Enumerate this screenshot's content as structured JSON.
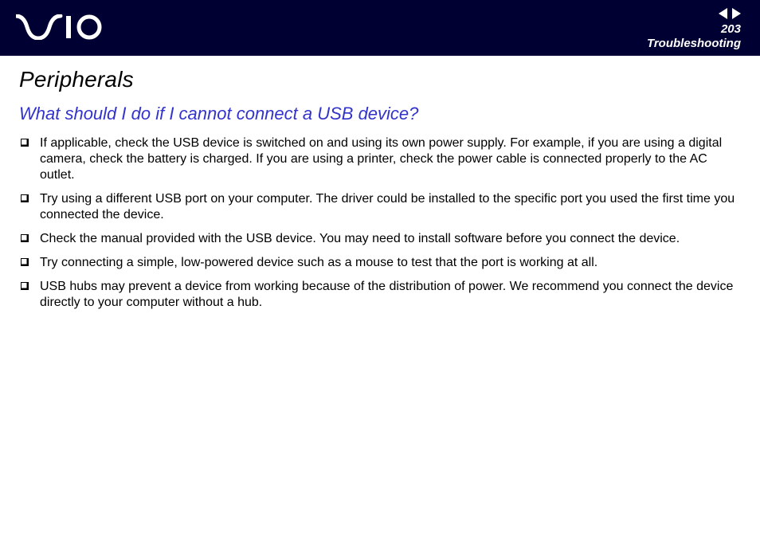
{
  "header": {
    "page_number": "203",
    "section": "Troubleshooting"
  },
  "content": {
    "title": "Peripherals",
    "question": "What should I do if I cannot connect a USB device?",
    "items": [
      "If applicable, check the USB device is switched on and using its own power supply. For example, if you are using a digital camera, check the battery is charged. If you are using a printer, check the power cable is connected properly to the AC outlet.",
      "Try using a different USB port on your computer. The driver could be installed to the specific port you used the first time you connected the device.",
      "Check the manual provided with the USB device. You may need to install software before you connect the device.",
      "Try connecting a simple, low-powered device such as a mouse to test that the port is working at all.",
      "USB hubs may prevent a device from working because of the distribution of power. We recommend you connect the device directly to your computer without a hub."
    ]
  }
}
